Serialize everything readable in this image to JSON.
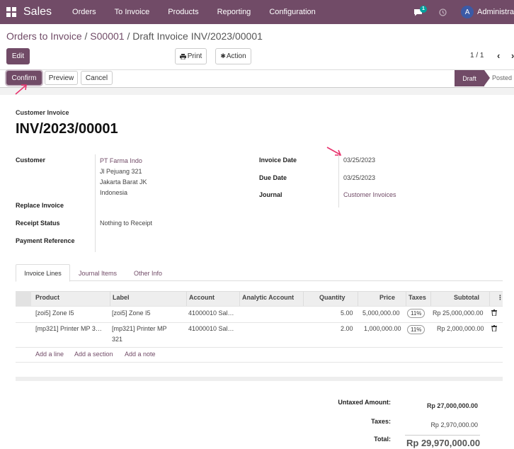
{
  "navbar": {
    "app_name": "Sales",
    "menu": [
      "Orders",
      "To Invoice",
      "Products",
      "Reporting",
      "Configuration"
    ],
    "chat_badge": "1",
    "avatar_letter": "A",
    "username": "Administra"
  },
  "breadcrumb": {
    "items": [
      "Orders to Invoice",
      "S00001"
    ],
    "separator": "/",
    "current": "Draft Invoice INV/2023/00001"
  },
  "toolbar": {
    "edit_label": "Edit",
    "print_label": "Print",
    "action_label": "Action",
    "pager": "1 / 1"
  },
  "statusbar": {
    "confirm_label": "Confirm",
    "preview_label": "Preview",
    "cancel_label": "Cancel",
    "stages": [
      "Draft",
      "Posted"
    ],
    "current_stage": "Draft"
  },
  "invoice": {
    "type_label": "Customer Invoice",
    "number": "INV/2023/00001",
    "customer_label": "Customer",
    "customer_lines": [
      "PT Farma Indo",
      "Jl Pejuang 321",
      "Jakarta Barat JK",
      "Indonesia"
    ],
    "replace_invoice_label": "Replace Invoice",
    "receipt_status_label": "Receipt Status",
    "receipt_status_value": "Nothing to Receipt",
    "payment_reference_label": "Payment Reference",
    "invoice_date_label": "Invoice Date",
    "invoice_date": "03/25/2023",
    "due_date_label": "Due Date",
    "due_date": "03/25/2023",
    "journal_label": "Journal",
    "journal": "Customer Invoices"
  },
  "tabs": [
    "Invoice Lines",
    "Journal Items",
    "Other Info"
  ],
  "lines": {
    "headers": [
      "Product",
      "Label",
      "Account",
      "Analytic Account",
      "Quantity",
      "Price",
      "Taxes",
      "Subtotal"
    ],
    "rows": [
      {
        "product": "[zoi5] Zone I5",
        "label": "[zoi5] Zone I5",
        "account": "41000010 Sal…",
        "analytic": "",
        "quantity": "5.00",
        "price": "5,000,000.00",
        "tax": "11%",
        "subtotal": "Rp 25,000,000.00"
      },
      {
        "product": "[mp321] Printer MP 3…",
        "label_1": "[mp321] Printer MP",
        "label_2": "321",
        "account": "41000010 Sal…",
        "analytic": "",
        "quantity": "2.00",
        "price": "1,000,000.00",
        "tax": "11%",
        "subtotal": "Rp 2,000,000.00"
      }
    ],
    "add_line": "Add a line",
    "add_section": "Add a section",
    "add_note": "Add a note"
  },
  "totals": {
    "untaxed_label": "Untaxed Amount:",
    "untaxed_value": "Rp 27,000,000.00",
    "taxes_label": "Taxes:",
    "taxes_value": "Rp 2,970,000.00",
    "total_label": "Total:",
    "total_value": "Rp 29,970,000.00"
  },
  "colors": {
    "brand": "#714B67",
    "annotation_arrow": "#e8336d"
  }
}
